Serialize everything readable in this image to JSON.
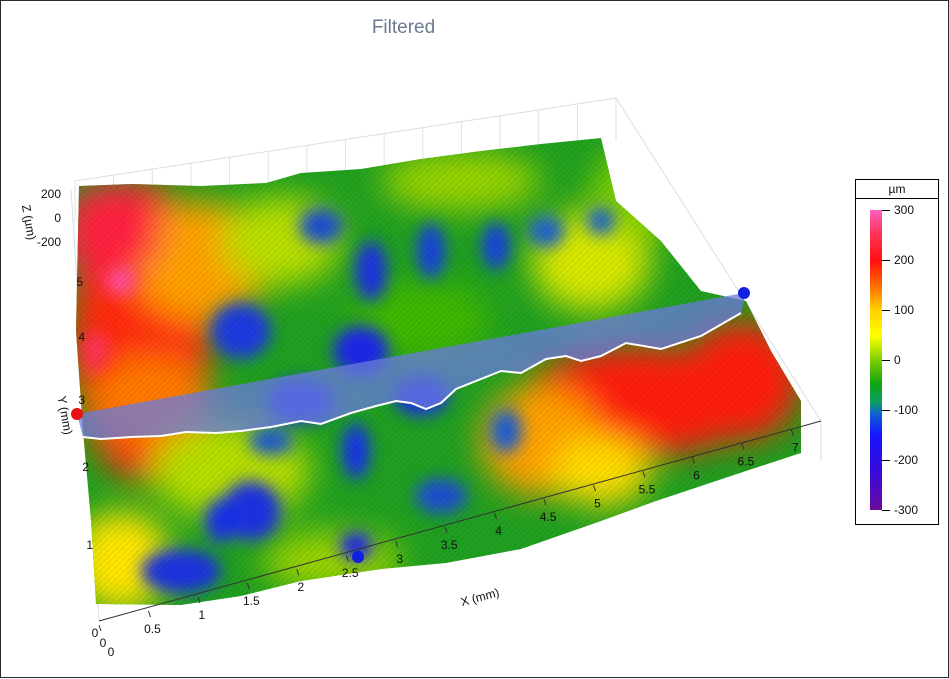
{
  "title": "Filtered",
  "chart_data": {
    "type": "surface3d",
    "title": "Filtered",
    "x_axis": {
      "label": "X (mm)",
      "ticks": [
        "0",
        "0.5",
        "1",
        "1.5",
        "2",
        "2.5",
        "3",
        "3.5",
        "4",
        "4.5",
        "5",
        "5.5",
        "6",
        "6.5",
        "7"
      ]
    },
    "y_axis": {
      "label": "Y (mm)",
      "ticks": [
        "1",
        "2",
        "3",
        "4",
        "5"
      ]
    },
    "z_axis": {
      "label": "Z (µm)",
      "ticks": [
        "200",
        "0",
        "-200"
      ]
    },
    "y_axis_origin": "0",
    "colorbar": {
      "unit": "µm",
      "ticks": [
        300,
        200,
        100,
        0,
        -100,
        -200,
        -300
      ],
      "range": [
        -300,
        300
      ]
    },
    "surface_regions": [
      {
        "area": "left edge (X 0–0.7 mm, Y 2.5–5 mm)",
        "height_um": 200
      },
      {
        "area": "right side (X 5–7 mm, Y 2.5–4 mm)",
        "height_um": 200
      },
      {
        "area": "center (X 2–4.5 mm)",
        "height_um": -80
      },
      {
        "area": "front edge (Y 0–1 mm)",
        "height_um": 0
      }
    ],
    "profile_line": {
      "start": {
        "x": 0,
        "y": 2.9
      },
      "end": {
        "x": 7.2,
        "y": 2.9
      }
    },
    "colors": {
      "profile_band": "#6a7adf",
      "marker_start": "#e81010",
      "marker_end": "#1020e0"
    }
  }
}
